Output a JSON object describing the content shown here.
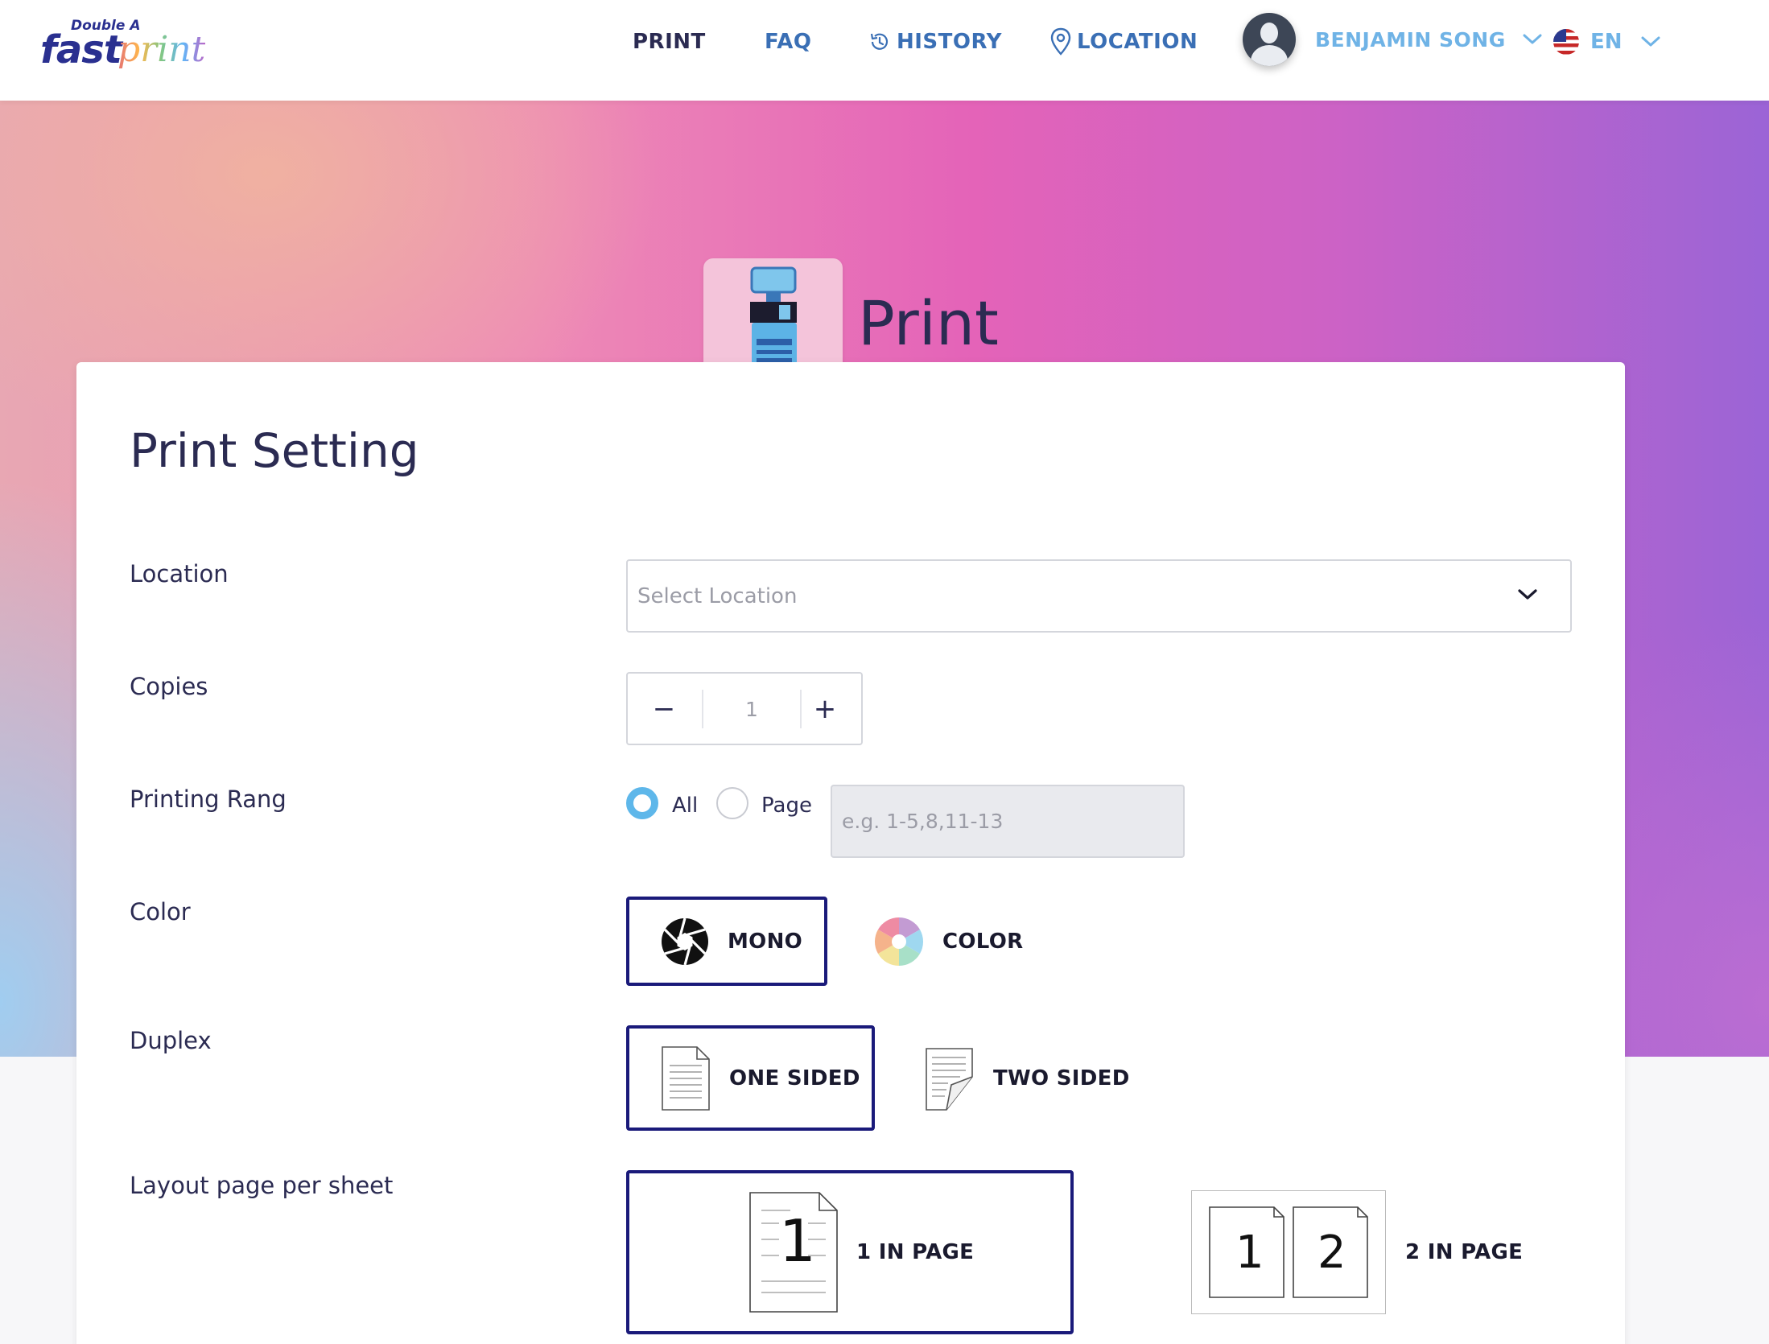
{
  "brand": {
    "logo_small": "Double A",
    "logo_fast": "fast",
    "logo_print": "print"
  },
  "nav": {
    "print": "PRINT",
    "faq": "FAQ",
    "history": "HISTORY",
    "location": "LOCATION"
  },
  "user": {
    "name": "BENJAMIN SONG"
  },
  "language": {
    "code": "EN"
  },
  "hero": {
    "title": "Print"
  },
  "form": {
    "title": "Print Setting",
    "location": {
      "label": "Location",
      "placeholder": "Select Location"
    },
    "copies": {
      "label": "Copies",
      "value": "1",
      "minus": "−",
      "plus": "+"
    },
    "range": {
      "label": "Printing Rang",
      "option_all": "All",
      "option_page": "Page",
      "placeholder": "e.g. 1-5,8,11-13",
      "selected": "All"
    },
    "color": {
      "label": "Color",
      "mono": "MONO",
      "color": "COLOR",
      "selected": "MONO"
    },
    "duplex": {
      "label": "Duplex",
      "one_sided": "ONE SIDED",
      "two_sided": "TWO SIDED",
      "selected": "ONE SIDED"
    },
    "layout": {
      "label": "Layout page per sheet",
      "one_in_page": "1 IN PAGE",
      "two_in_page": "2 IN PAGE",
      "selected": "1 IN PAGE",
      "icon1_digit": "1",
      "icon2_digit_a": "1",
      "icon2_digit_b": "2"
    }
  },
  "colors": {
    "primary_text": "#2b2b52",
    "link_blue": "#3a6fb5",
    "accent_light_blue": "#6fb3e6",
    "selected_border": "#1a1a7a",
    "radio_on": "#5eb7ea"
  }
}
